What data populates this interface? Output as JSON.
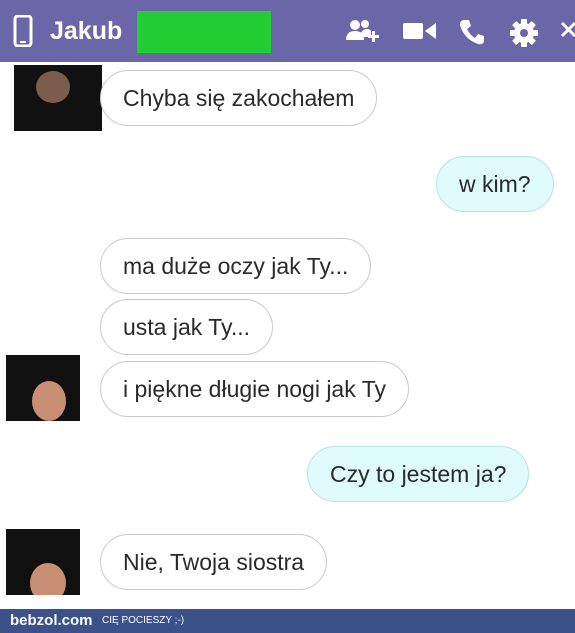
{
  "header": {
    "contact_name": "Jakub",
    "background": "#6a66a8",
    "censor_color": "#22cc33",
    "icons": [
      "phone-device-icon",
      "add-person-icon",
      "video-call-icon",
      "call-icon",
      "settings-icon",
      "close-icon"
    ]
  },
  "messages": [
    {
      "from": "contact",
      "text": "Chyba się zakochałem"
    },
    {
      "from": "me",
      "text": "w kim?"
    },
    {
      "from": "contact",
      "text": "ma duże oczy jak Ty..."
    },
    {
      "from": "contact",
      "text": "usta jak Ty..."
    },
    {
      "from": "contact",
      "text": "i piękne długie nogi jak Ty"
    },
    {
      "from": "me",
      "text": "Czy to jestem ja?"
    },
    {
      "from": "contact",
      "text": "Nie, Twoja siostra"
    }
  ],
  "footer": {
    "brand": "bebzol.com",
    "slogan": "CIĘ POCIESZY ;-)",
    "background": "#3c5089"
  },
  "colors": {
    "incoming_bubble": "#ffffff",
    "outgoing_bubble": "#dffbfa",
    "bubble_border": "#c9c9cf"
  }
}
